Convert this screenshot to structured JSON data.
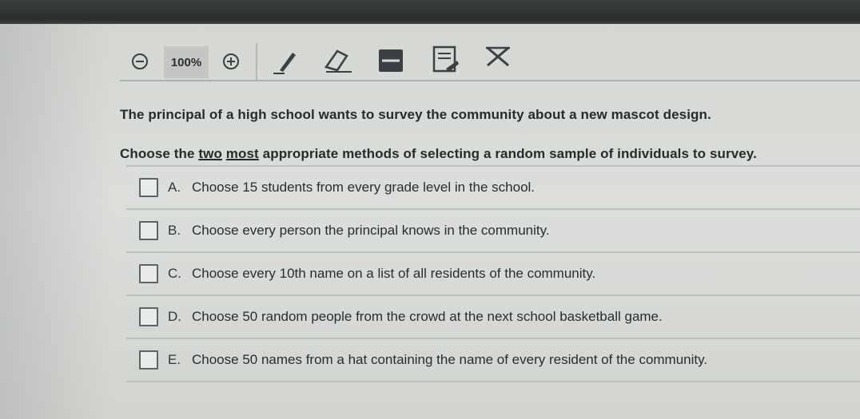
{
  "toolbar": {
    "zoom_label": "100%",
    "icons": [
      "zoom-out-icon",
      "zoom-in-icon",
      "pencil-icon",
      "eraser-icon",
      "highlighter-icon",
      "note-icon",
      "cross-out-icon"
    ]
  },
  "question": {
    "prompt": "The principal of a high school wants to survey the community about a new mascot design.",
    "instruction_pre": "Choose the ",
    "instruction_two": "two",
    "instruction_most": "most",
    "instruction_post": " appropriate methods of selecting a random sample of individuals to survey."
  },
  "options": [
    {
      "letter": "A.",
      "text": "Choose 15 students from every grade level in the school.",
      "checked": false
    },
    {
      "letter": "B.",
      "text": "Choose every person the principal knows in the community.",
      "checked": false
    },
    {
      "letter": "C.",
      "text": "Choose every 10th name on a list of all residents of the community.",
      "checked": false
    },
    {
      "letter": "D.",
      "text": "Choose 50 random people from the crowd at the next school basketball game.",
      "checked": false
    },
    {
      "letter": "E.",
      "text": "Choose 50 names from a hat containing the name of every resident of the community.",
      "checked": false
    }
  ],
  "colors": {
    "text": "#262b30",
    "background": "#d8dad6",
    "bezel": "#2e3132"
  }
}
